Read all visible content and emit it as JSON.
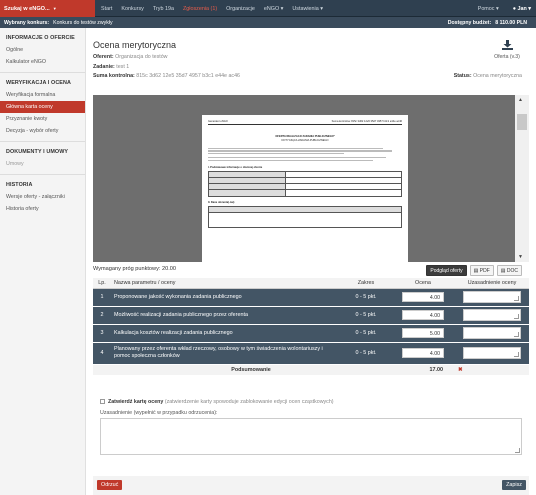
{
  "topbar": {
    "brand": "Szukaj w eNGO...",
    "nav": [
      {
        "label": "Start",
        "highlight": false
      },
      {
        "label": "Konkursy",
        "highlight": false
      },
      {
        "label": "Tryb 19a",
        "highlight": false
      },
      {
        "label": "Zgłoszenia (1)",
        "highlight": true
      },
      {
        "label": "Organizacje",
        "highlight": false
      },
      {
        "label": "eNGO",
        "highlight": false,
        "dropdown": true
      },
      {
        "label": "Ustawienia",
        "highlight": false,
        "dropdown": true
      }
    ],
    "help": "Pomoc",
    "user": "Jan"
  },
  "subbar": {
    "selected_label": "Wybrany konkurs:",
    "selected_value": "Konkurs do testów zwykły",
    "budget_label": "Dostępny budżet:",
    "budget_value": "8 110.00 PLN"
  },
  "sidebar": [
    {
      "head": "INFORMACJE O OFERCIE",
      "items": [
        {
          "label": "Ogólne"
        },
        {
          "label": "Kalkulator eNGO"
        }
      ]
    },
    {
      "head": "WERYFIKACJA I OCENA",
      "items": [
        {
          "label": "Weryfikacja formalna"
        },
        {
          "label": "Główna karta oceny",
          "active": true
        },
        {
          "label": "Przyznanie kwoty"
        },
        {
          "label": "Decyzja - wybór oferty"
        }
      ]
    },
    {
      "head": "DOKUMENTY I UMOWY",
      "items": [
        {
          "label": "Umowy",
          "muted": true
        }
      ]
    },
    {
      "head": "HISTORIA",
      "items": [
        {
          "label": "Wersje oferty - załączniki"
        },
        {
          "label": "Historia oferty"
        }
      ]
    }
  ],
  "main": {
    "title": "Ocena merytoryczna",
    "offerer_label": "Oferent:",
    "offerer_value": "Organizacja do testów",
    "task_label": "Zadanie:",
    "task_value": "test 1",
    "checksum_label": "Suma kontrolna:",
    "checksum_value": "815c 3d62 12e5 35d7 4957 b3c1 e44e ac46",
    "status_label": "Status:",
    "status_value": "Ocena merytoryczna",
    "download_label": "Oferta (v.3)"
  },
  "pdf_preview": {
    "header_left": "Generator eNGO",
    "header_right": "Suma kontrolna: 815c 3d62 12e5 35d7 4957 b3c1 e44e ac46",
    "heading1": "OFERTA REALIZACJI ZADANIA PUBLICZNEGO*",
    "heading2": "DOTYCZĄCA ZADANIA PUBLICZNEGO",
    "section1": "I. Podstawowe informacje o złożonej ofercie",
    "section2": "II. Dane oferenta(-ów)"
  },
  "scoring": {
    "required_label": "Wymagany próg punktowy: 20.00",
    "btn_preview": "Podgląd oferty",
    "btn_pdf": "PDF",
    "btn_doc": "DOC",
    "columns": {
      "lp": "Lp.",
      "name": "Nazwa parametru / oceny",
      "range": "Zakres",
      "score": "Ocena",
      "justification": "Uzasadnienie oceny"
    },
    "rows": [
      {
        "lp": "1",
        "name": "Proponowane jakość wykonania zadania publicznego",
        "range": "0 - 5 pkt.",
        "score": "4.00"
      },
      {
        "lp": "2",
        "name": "Możliwość realizacji zadania publicznego przez oferenta",
        "range": "0 - 5 pkt.",
        "score": "4.00"
      },
      {
        "lp": "3",
        "name": "Kalkulacja kosztów realizacji zadania publicznego",
        "range": "0 - 5 pkt.",
        "score": "5.00"
      },
      {
        "lp": "4",
        "name": "Planowany przez oferenta wkład rzeczowy, osobowy w tym świadczenia wolontariuszy i pomoc społeczna członków",
        "range": "0 - 5 pkt.",
        "score": "4.00"
      }
    ],
    "sum_label": "Podsumowanie",
    "sum_value": "17.00",
    "sum_mark": "✖"
  },
  "confirm": {
    "label": "Zatwierdź kartę oceny",
    "hint": "(zatwierdzenie karty spowoduje zablokowanie edycji ocen cząstkowych)",
    "justification_label": "Uzasadnienie (wypełnić w przypadku odrzucenia):"
  },
  "footer": {
    "reject": "Odrzuć",
    "save": "Zapisz"
  }
}
